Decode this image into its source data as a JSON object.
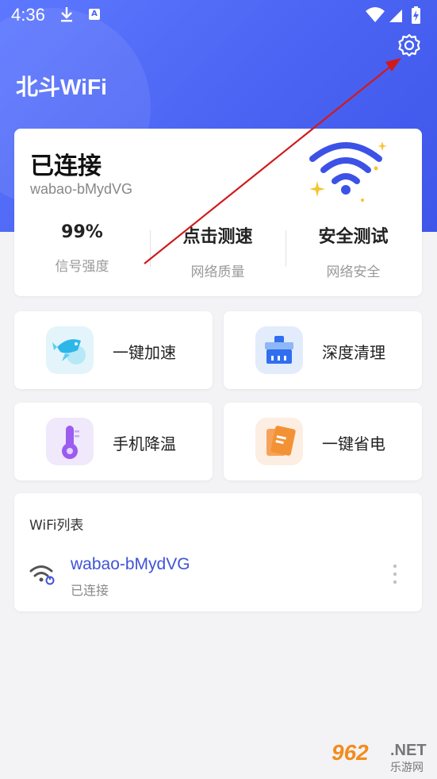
{
  "status_bar": {
    "time": "4:36"
  },
  "header": {
    "title": "北斗WiFi"
  },
  "connection": {
    "title": "已连接",
    "ssid": "wabao-bMydVG",
    "stats": [
      {
        "value": "99%",
        "label": "信号强度"
      },
      {
        "value": "点击测速",
        "label": "网络质量"
      },
      {
        "value": "安全测试",
        "label": "网络安全"
      }
    ]
  },
  "features": [
    {
      "label": "一键加速",
      "icon": "rocket-fish-icon",
      "bg": "#e4f4fb"
    },
    {
      "label": "深度清理",
      "icon": "broom-icon",
      "bg": "#e3ecfb"
    },
    {
      "label": "手机降温",
      "icon": "thermometer-icon",
      "bg": "#f0e8fb"
    },
    {
      "label": "一键省电",
      "icon": "battery-save-icon",
      "bg": "#fdeee3"
    }
  ],
  "wifi_list": {
    "title": "WiFi列表",
    "items": [
      {
        "ssid": "wabao-bMydVG",
        "status": "已连接"
      }
    ]
  },
  "watermark": {
    "number": "962",
    "suffix": ".NET",
    "cn": "乐游网"
  },
  "colors": {
    "accent": "#4a63f2",
    "link": "#3f53d6",
    "arrow": "#d11a1a"
  }
}
